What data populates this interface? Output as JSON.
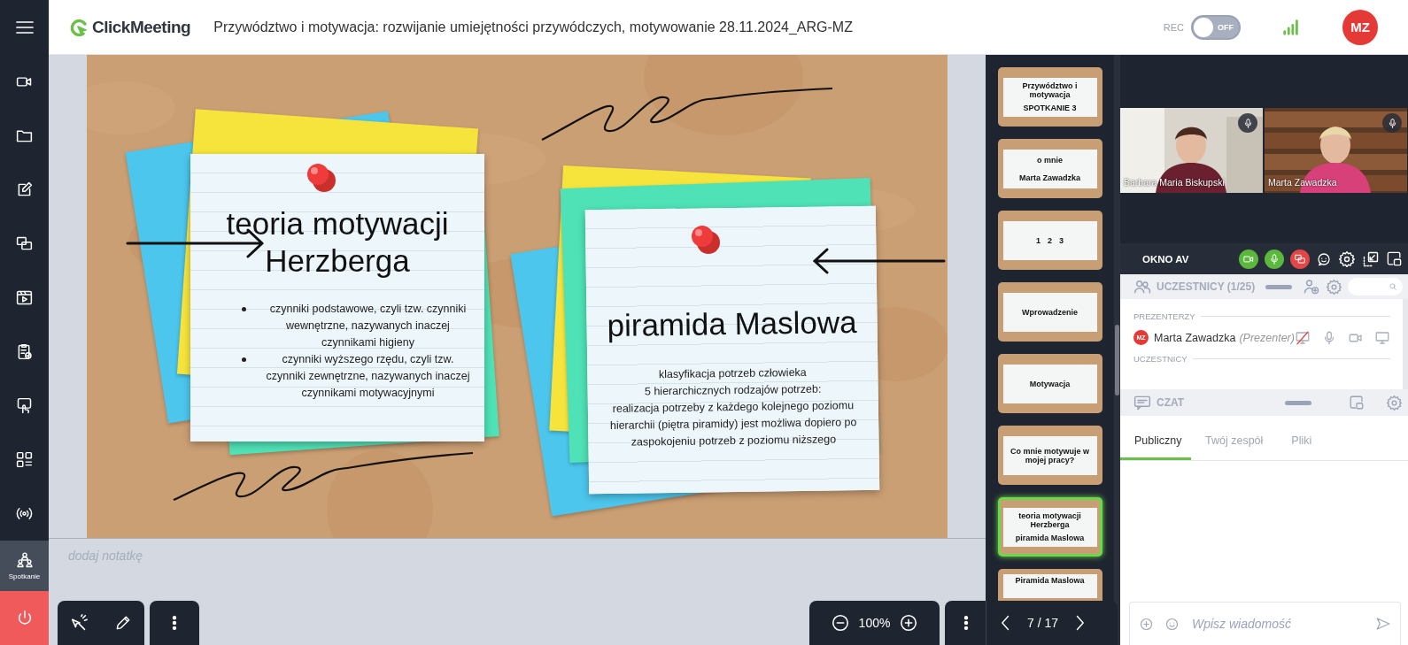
{
  "topbar": {
    "logo": "ClickMeeting",
    "title": "Przywództwo i motywacja: rozwijanie umiejętności przywódczych, motywowanie 28.11.2024_ARG-MZ",
    "rec": {
      "label": "REC",
      "on": false,
      "state_label": "OFF"
    },
    "avatar": "MZ"
  },
  "sidebar": {
    "items": [
      {
        "label": "Spotkanie",
        "selected": true
      }
    ]
  },
  "slide": {
    "notes": [
      {
        "kind": "bullets",
        "title": "teoria motywacji Herzberga",
        "items": [
          "czynniki podstawowe, czyli tzw. czynniki wewnętrzne, nazywanych inaczej czynnikami higieny",
          "czynniki wyższego rzędu, czyli tzw. czynniki zewnętrzne, nazywanych inaczej czynnikami motywacyjnymi"
        ]
      },
      {
        "kind": "lines",
        "title": "piramida Maslowa",
        "items": [
          "klasyfikacja potrzeb człowieka",
          "5 hierarchicznych rodzajów potrzeb:",
          "realizacja potrzeby z każdego kolejnego poziomu hierarchii (piętra piramidy) jest możliwa dopiero po zaspokojeniu potrzeb z poziomu niższego"
        ]
      }
    ]
  },
  "notes_field": {
    "placeholder": "dodaj notatkę"
  },
  "toolbar": {
    "zoom": "100%",
    "page": "7 / 17"
  },
  "thumbnails": [
    {
      "selected": false,
      "texts": [
        "Przywództwo i motywacja",
        "SPOTKANIE 3"
      ]
    },
    {
      "selected": false,
      "texts": [
        "o mnie",
        "Marta Zawadzka"
      ]
    },
    {
      "selected": false,
      "texts": [
        "1",
        "2",
        "3"
      ]
    },
    {
      "selected": false,
      "texts": [
        "Wprowadzenie"
      ]
    },
    {
      "selected": false,
      "texts": [
        "Motywacja"
      ]
    },
    {
      "selected": false,
      "texts": [
        "Co mnie motywuje w mojej pracy?"
      ]
    },
    {
      "selected": true,
      "texts": [
        "teoria motywacji Herzberga",
        "piramida Maslowa"
      ]
    },
    {
      "selected": false,
      "texts": [
        "Piramida Maslowa"
      ]
    }
  ],
  "video": {
    "tiles": [
      {
        "name": "Barbara Maria Biskupski"
      },
      {
        "name": "Marta Zawadzka"
      }
    ]
  },
  "av_bar": {
    "title": "OKNO AV",
    "camera_on": true,
    "mic_on": true,
    "screen_on": false
  },
  "participants": {
    "title": "UCZESTNICY (1/25)",
    "groups": [
      {
        "label": "PREZENTERZY",
        "members": [
          {
            "initials": "MZ",
            "name": "Marta Zawadzka",
            "role": "(Prezenter)"
          }
        ]
      },
      {
        "label": "UCZESTNICY"
      }
    ]
  },
  "chat": {
    "title": "CZAT",
    "tabs": [
      {
        "label": "Publiczny",
        "selected": true
      },
      {
        "label": "Twój zespół",
        "selected": false
      },
      {
        "label": "Pliki",
        "selected": false
      }
    ],
    "input": {
      "placeholder": "Wpisz wiadomość"
    }
  }
}
